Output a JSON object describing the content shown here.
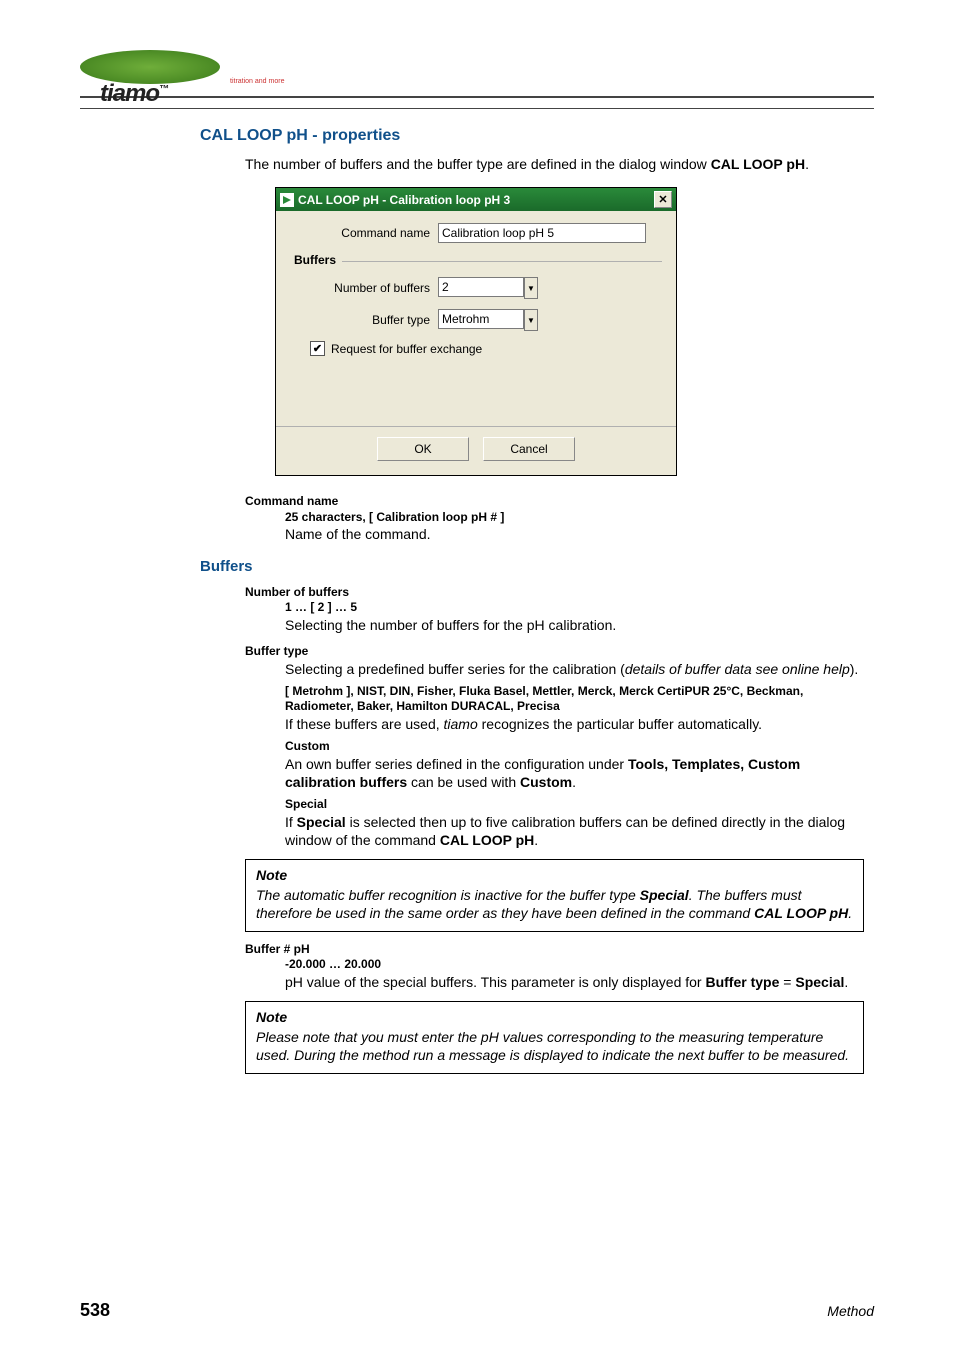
{
  "logo": {
    "text": "tiamo",
    "sup": "™",
    "sub": "titration and more"
  },
  "section_title": "CAL LOOP pH - properties",
  "intro_text": "The number of buffers and the buffer type are defined in the dialog window ",
  "intro_bold": "CAL LOOP pH",
  "intro_period": ".",
  "dialog": {
    "title": "CAL LOOP pH - Calibration loop pH 3",
    "row_cmd_label": "Command name",
    "row_cmd_value": "Calibration loop pH 5",
    "group_label": "Buffers",
    "row_num_label": "Number of buffers",
    "row_num_value": "2",
    "row_type_label": "Buffer type",
    "row_type_value": "Metrohm",
    "checkbox_label": "Request for buffer exchange",
    "ok": "OK",
    "cancel": "Cancel"
  },
  "defs": {
    "cmd_name_term": "Command name",
    "cmd_name_range": "25 characters, [ Calibration loop pH # ]",
    "cmd_name_desc": "Name of the command.",
    "buffers_head": "Buffers",
    "num_term": "Number of buffers",
    "num_range": "1 … [ 2 ] … 5",
    "num_desc": "Selecting the number of buffers for the pH calibration.",
    "type_term": "Buffer type",
    "type_desc_pre": "Selecting a predefined buffer series for the calibration (",
    "type_desc_italic": "details of buffer data see online help",
    "type_desc_post": ").",
    "type_list": "[ Metrohm ], NIST, DIN, Fisher, Fluka Basel, Mettler, Merck, Merck CertiPUR 25°C, Beckman, Radiometer, Baker, Hamilton DURACAL, Precisa",
    "type_list_desc_pre": "If these buffers are used, ",
    "type_list_desc_it": "tiamo",
    "type_list_desc_post": " recognizes the particular buffer automatically.",
    "custom_term": "Custom",
    "custom_desc_pre": "An own buffer series defined in the configuration under ",
    "custom_desc_b1": "Tools, Templates, Custom calibration buffers",
    "custom_desc_mid": " can be used with ",
    "custom_desc_b2": "Custom",
    "custom_desc_post": ".",
    "special_term": "Special",
    "special_desc_pre": "If ",
    "special_desc_b1": "Special",
    "special_desc_mid": " is selected then up to five calibration buffers can be defined directly in the dialog window of the command ",
    "special_desc_b2": "CAL LOOP pH",
    "special_desc_post": ".",
    "bufferph_term": "Buffer # pH",
    "bufferph_range": "-20.000 … 20.000",
    "bufferph_desc_pre": "pH value of the special buffers. This parameter is only displayed for ",
    "bufferph_desc_b1": "Buffer type",
    "bufferph_desc_eq": " = ",
    "bufferph_desc_b2": "Special",
    "bufferph_desc_post": "."
  },
  "note1": {
    "title": "Note",
    "t1": "The automatic buffer recognition is inactive for the buffer type ",
    "b1": "Special",
    "t2": ". The buffers must therefore be used in the same order as they have been defined in the command ",
    "b2": "CAL LOOP pH",
    "t3": "."
  },
  "note2": {
    "title": "Note",
    "text": "Please note that you must enter the pH values corresponding to the measuring temperature used. During the method run a message is displayed to indicate the next buffer to be measured."
  },
  "footer": {
    "page": "538",
    "right": "Method"
  }
}
